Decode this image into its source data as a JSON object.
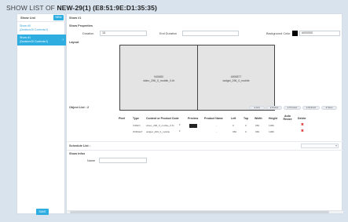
{
  "page": {
    "title_prefix": "SHOW LIST OF ",
    "title_name": "NEW-29(1) (E8:51:9E:D1:35:35)"
  },
  "sidebar": {
    "header_label": "Show List",
    "new_label": "NEW",
    "items": [
      {
        "title": "Show #0",
        "subtitle": "(Duration:00 Contents:0)"
      },
      {
        "title": "Show #1",
        "subtitle": "(Duration:00 Contents:2)"
      }
    ],
    "save_label": "SAVE"
  },
  "main": {
    "header": "Show #1",
    "properties_label": "Show Properties",
    "duration_label": "Duration",
    "duration_value": "15",
    "end_duration_label": "End Duration",
    "end_duration_value": "",
    "bg_color_label": "Background Color",
    "bg_color_value": "#000000",
    "bg_color_hex": "#000000",
    "layout_label": "Layout",
    "panels": [
      {
        "id": "940683",
        "name": "video_296_0_mobile_0.bt"
      },
      {
        "id": "4893877",
        "name": "widget_296_0_mobile"
      }
    ],
    "object_list_label": "Object List : 2",
    "object_actions": [
      "● Add",
      "● Delete",
      "● Preview",
      "● Refresh",
      "● Save"
    ],
    "columns": [
      "Pixel",
      "Type",
      "Content or Product Code",
      "Preview",
      "Product Name",
      "Left",
      "Top",
      "Width",
      "Height",
      "Auto Resize",
      "Delete"
    ],
    "rows": [
      {
        "pixel": "",
        "type": "VIDEO",
        "code": "video_296_0_mobile_0.bt",
        "product_name": "-",
        "left": "0",
        "top": "0",
        "width": "960",
        "height": "1080"
      },
      {
        "pixel": "",
        "type": "WIDGET",
        "code": "widget_296_0_mobile",
        "product_name": "-",
        "left": "960",
        "top": "0",
        "width": "960",
        "height": "1080"
      }
    ],
    "schedule_label": "Schedule List :",
    "show_info_label": "Show Infos",
    "name_label": "Name",
    "name_value": ""
  }
}
